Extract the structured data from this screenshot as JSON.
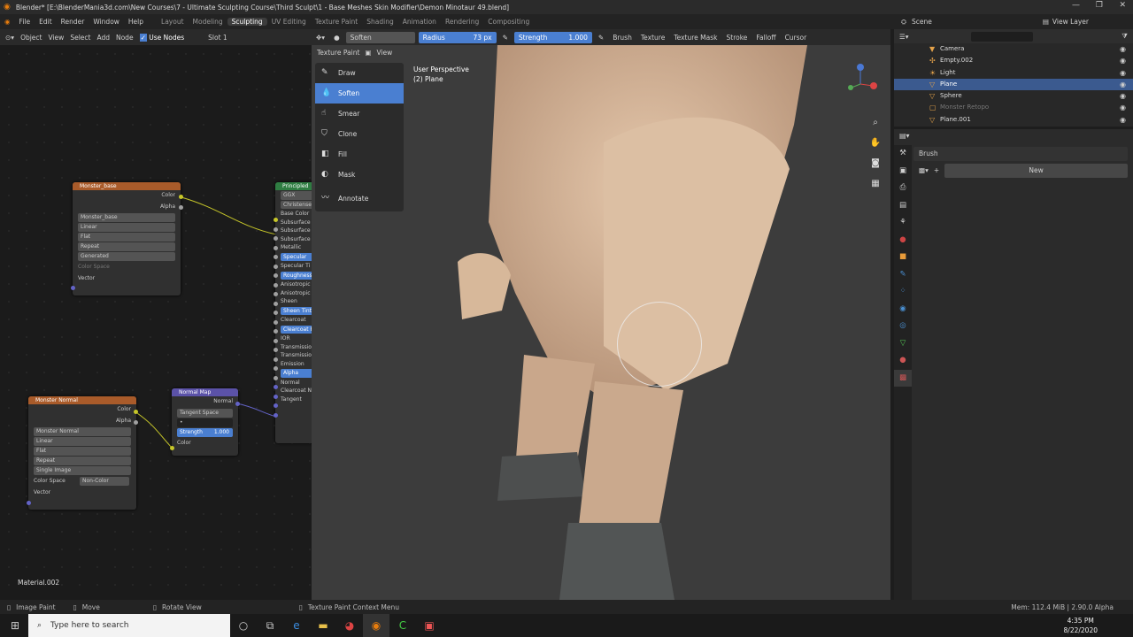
{
  "window": {
    "title": "Blender* [E:\\BlenderMania3d.com\\New Courses\\7 - Ultimate Sculpting Course\\Third Sculpt\\1 - Base Meshes Skin Modifier\\Demon Minotaur 49.blend]"
  },
  "menu": {
    "items": [
      "File",
      "Edit",
      "Render",
      "Window",
      "Help"
    ],
    "workspaces": [
      "Layout",
      "Modeling",
      "Sculpting",
      "UV Editing",
      "Texture Paint",
      "Shading",
      "Animation",
      "Rendering",
      "Compositing"
    ],
    "active_workspace": "Sculpting"
  },
  "scenebar": {
    "scene": "Scene",
    "view_layer": "View Layer"
  },
  "node_header": {
    "mode": "Object",
    "view": "View",
    "select": "Select",
    "add": "Add",
    "node": "Node",
    "use_nodes": "Use Nodes",
    "slot": "Slot 1"
  },
  "nodes": {
    "monster_base": {
      "title": "Monster_base",
      "out1": "Color",
      "out2": "Alpha",
      "image": "Monster_base",
      "interp": "Linear",
      "proj": "Flat",
      "ext": "Repeat",
      "source": "Generated",
      "colorspace": "Color Space",
      "vector": "Vector"
    },
    "monster_normal": {
      "title": "Monster Normal",
      "out1": "Color",
      "out2": "Alpha",
      "image": "Monster Normal",
      "interp": "Linear",
      "proj": "Flat",
      "ext": "Repeat",
      "source": "Single Image",
      "colorspace_label": "Color Space",
      "colorspace": "Non-Color",
      "vector": "Vector"
    },
    "normal_map": {
      "title": "Normal Map",
      "out": "Normal",
      "space": "Tangent Space",
      "strength_label": "Strength",
      "strength": "1.000",
      "color": "Color"
    },
    "principled": {
      "title": "Principled",
      "rows": [
        "GGX",
        "Christensen",
        "Base Color",
        "Subsurface",
        "Subsurface",
        "Subsurface R",
        "Metallic",
        "Specular",
        "Specular Ti",
        "Roughness",
        "Anisotropic",
        "Anisotropic",
        "Sheen",
        "Sheen Tint",
        "Clearcoat",
        "Clearcoat R",
        "IOR",
        "Transmission",
        "Transmission",
        "Emission",
        "Alpha",
        "Normal",
        "Clearcoat N",
        "Tangent"
      ],
      "highlighted": [
        7,
        9,
        13,
        15,
        20
      ]
    }
  },
  "viewport_header": {
    "brush": "Soften",
    "radius_label": "Radius",
    "radius": "73 px",
    "strength_label": "Strength",
    "strength": "1.000",
    "menus": [
      "Brush",
      "Texture",
      "Texture Mask",
      "Stroke",
      "Falloff",
      "Cursor"
    ]
  },
  "viewport": {
    "mode": "Texture Paint",
    "view": "View",
    "perspective": "User Perspective",
    "object": "(2) Plane"
  },
  "tool_menu": {
    "items": [
      {
        "label": "Draw",
        "icon": "brush-icon"
      },
      {
        "label": "Soften",
        "icon": "drop-icon",
        "active": true
      },
      {
        "label": "Smear",
        "icon": "smear-icon"
      },
      {
        "label": "Clone",
        "icon": "stamp-icon"
      },
      {
        "label": "Fill",
        "icon": "bucket-icon"
      },
      {
        "label": "Mask",
        "icon": "mask-icon"
      },
      {
        "label": "Annotate",
        "icon": "pen-icon"
      }
    ]
  },
  "outliner": {
    "rows": [
      {
        "label": "Camera",
        "icon": "camera-icon"
      },
      {
        "label": "Empty.002",
        "icon": "empty-icon"
      },
      {
        "label": "Light",
        "icon": "light-icon"
      },
      {
        "label": "Plane",
        "icon": "mesh-icon",
        "selected": true
      },
      {
        "label": "Sphere",
        "icon": "mesh-icon"
      },
      {
        "label": "Monster Retopo",
        "icon": "collection-icon",
        "dim": true
      },
      {
        "label": "Plane.001",
        "icon": "mesh-icon"
      }
    ]
  },
  "properties": {
    "brush_label": "Brush",
    "new_button": "New"
  },
  "material": "Material.002",
  "status": {
    "image_paint": "Image Paint",
    "move": "Move",
    "rotate": "Rotate View",
    "context": "Texture Paint Context Menu",
    "mem": "Mem: 112.4 MiB | 2.90.0 Alpha"
  },
  "taskbar": {
    "search_placeholder": "Type here to search",
    "time": "4:35 PM",
    "date": "8/22/2020"
  },
  "colors": {
    "accent": "#4a7fd1",
    "texture_node": "#a95b2a",
    "vector_node": "#5b52a8",
    "shader_node": "#2f7d42"
  }
}
